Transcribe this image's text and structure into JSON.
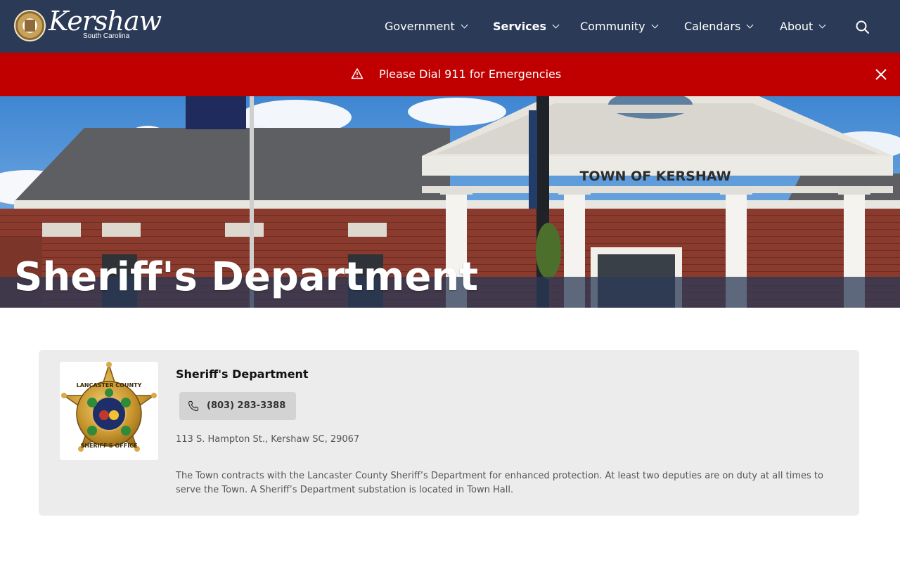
{
  "brand": {
    "name": "Kershaw",
    "subtitle": "South Carolina"
  },
  "nav": {
    "items": [
      {
        "label": "Government",
        "active": false
      },
      {
        "label": "Services",
        "active": true
      },
      {
        "label": "Community",
        "active": false
      },
      {
        "label": "Calendars",
        "active": false
      },
      {
        "label": "About",
        "active": false
      }
    ],
    "search_icon": "search-icon"
  },
  "alert": {
    "icon": "warning-icon",
    "text": "Please Dial 911 for Emergencies",
    "close_icon": "close-icon"
  },
  "hero": {
    "title": "Sheriff's Department",
    "building_sign": "TOWN OF KERSHAW"
  },
  "card": {
    "name": "Sheriff's Department",
    "phone": "(803) 283-3388",
    "address": "113 S. Hampton St., Kershaw SC, 29067",
    "description": "The Town contracts with the Lancaster County Sheriff’s Department for enhanced protection.  At least two deputies are on duty at all times to serve the Town.  A Sheriff’s Department substation is located in Town Hall.",
    "badge": {
      "top_text": "LANCASTER COUNTY",
      "bottom_text": "SHERIFF'S OFFICE"
    }
  },
  "colors": {
    "header_bg": "#2b3a57",
    "alert_bg": "#c00000",
    "card_bg": "#ececec",
    "phone_button_bg": "#d3d3d3"
  }
}
